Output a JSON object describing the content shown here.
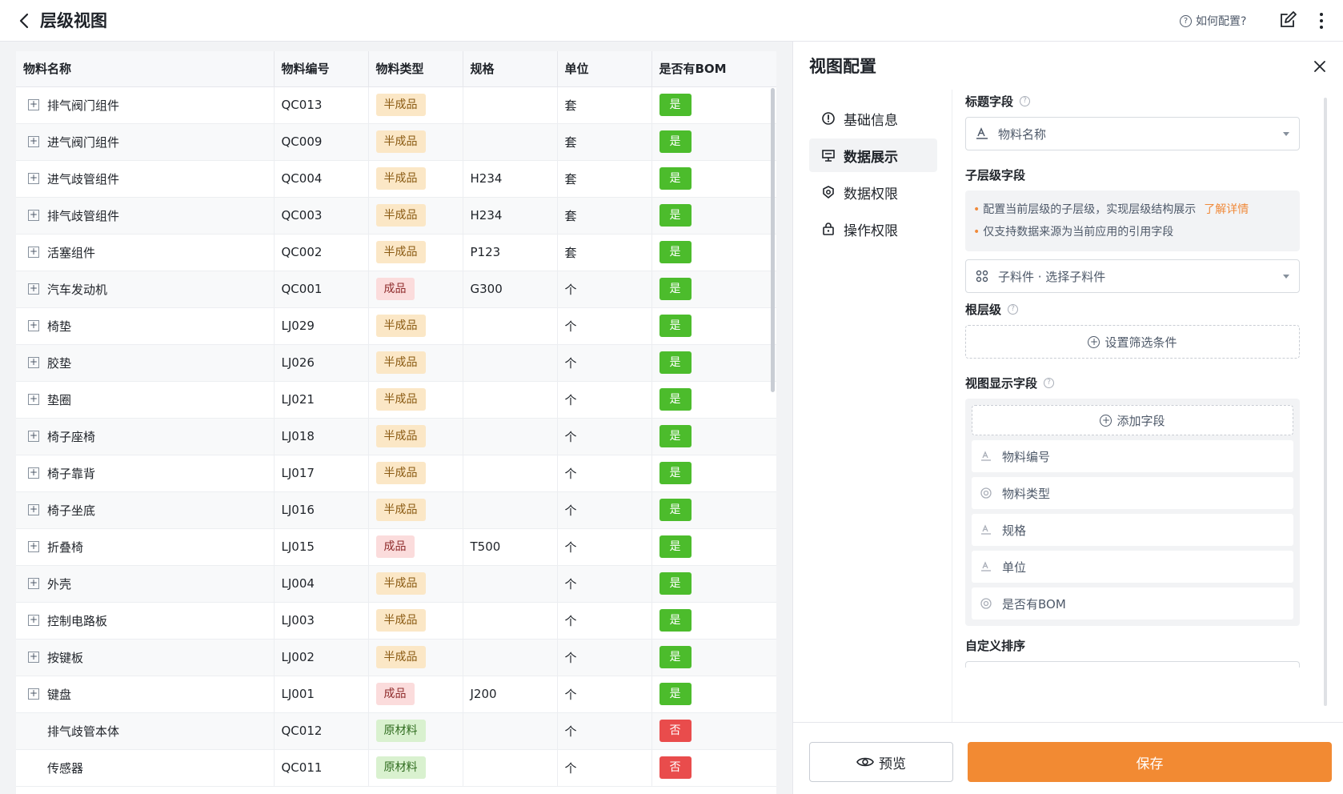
{
  "header": {
    "title": "层级视图",
    "help_label": "如何配置?"
  },
  "table": {
    "columns": [
      "物料名称",
      "物料编号",
      "物料类型",
      "规格",
      "单位",
      "是否有BOM"
    ],
    "rows": [
      {
        "name": "排气阀门组件",
        "code": "QC013",
        "type": "半成品",
        "spec": "",
        "unit": "套",
        "bom": "是",
        "expandable": true
      },
      {
        "name": "进气阀门组件",
        "code": "QC009",
        "type": "半成品",
        "spec": "",
        "unit": "套",
        "bom": "是",
        "expandable": true
      },
      {
        "name": "进气歧管组件",
        "code": "QC004",
        "type": "半成品",
        "spec": "H234",
        "unit": "套",
        "bom": "是",
        "expandable": true
      },
      {
        "name": "排气歧管组件",
        "code": "QC003",
        "type": "半成品",
        "spec": "H234",
        "unit": "套",
        "bom": "是",
        "expandable": true
      },
      {
        "name": "活塞组件",
        "code": "QC002",
        "type": "半成品",
        "spec": "P123",
        "unit": "套",
        "bom": "是",
        "expandable": true
      },
      {
        "name": "汽车发动机",
        "code": "QC001",
        "type": "成品",
        "spec": "G300",
        "unit": "个",
        "bom": "是",
        "expandable": true
      },
      {
        "name": "椅垫",
        "code": "LJ029",
        "type": "半成品",
        "spec": "",
        "unit": "个",
        "bom": "是",
        "expandable": true
      },
      {
        "name": "胶垫",
        "code": "LJ026",
        "type": "半成品",
        "spec": "",
        "unit": "个",
        "bom": "是",
        "expandable": true
      },
      {
        "name": "垫圈",
        "code": "LJ021",
        "type": "半成品",
        "spec": "",
        "unit": "个",
        "bom": "是",
        "expandable": true
      },
      {
        "name": "椅子座椅",
        "code": "LJ018",
        "type": "半成品",
        "spec": "",
        "unit": "个",
        "bom": "是",
        "expandable": true
      },
      {
        "name": "椅子靠背",
        "code": "LJ017",
        "type": "半成品",
        "spec": "",
        "unit": "个",
        "bom": "是",
        "expandable": true
      },
      {
        "name": "椅子坐底",
        "code": "LJ016",
        "type": "半成品",
        "spec": "",
        "unit": "个",
        "bom": "是",
        "expandable": true
      },
      {
        "name": "折叠椅",
        "code": "LJ015",
        "type": "成品",
        "spec": "T500",
        "unit": "个",
        "bom": "是",
        "expandable": true
      },
      {
        "name": "外壳",
        "code": "LJ004",
        "type": "半成品",
        "spec": "",
        "unit": "个",
        "bom": "是",
        "expandable": true
      },
      {
        "name": "控制电路板",
        "code": "LJ003",
        "type": "半成品",
        "spec": "",
        "unit": "个",
        "bom": "是",
        "expandable": true
      },
      {
        "name": "按键板",
        "code": "LJ002",
        "type": "半成品",
        "spec": "",
        "unit": "个",
        "bom": "是",
        "expandable": true
      },
      {
        "name": "键盘",
        "code": "LJ001",
        "type": "成品",
        "spec": "J200",
        "unit": "个",
        "bom": "是",
        "expandable": true
      },
      {
        "name": "排气歧管本体",
        "code": "QC012",
        "type": "原材料",
        "spec": "",
        "unit": "个",
        "bom": "否",
        "expandable": false
      },
      {
        "name": "传感器",
        "code": "QC011",
        "type": "原材料",
        "spec": "",
        "unit": "个",
        "bom": "否",
        "expandable": false
      }
    ]
  },
  "panel": {
    "title": "视图配置",
    "nav": [
      {
        "label": "基础信息",
        "icon": "info-icon",
        "active": false
      },
      {
        "label": "数据展示",
        "icon": "display-icon",
        "active": true
      },
      {
        "label": "数据权限",
        "icon": "data-permission-icon",
        "active": false
      },
      {
        "label": "操作权限",
        "icon": "lock-icon",
        "active": false
      }
    ],
    "title_field": {
      "label": "标题字段",
      "value": "物料名称"
    },
    "child_field": {
      "label": "子层级字段",
      "note1": "配置当前层级的子层级，实现层级结构展示",
      "note1_link": "了解详情",
      "note2": "仅支持数据来源为当前应用的引用字段",
      "value": "子料件 · 选择子料件"
    },
    "root": {
      "label": "根层级",
      "button": "设置筛选条件"
    },
    "display_fields": {
      "label": "视图显示字段",
      "add_button": "添加字段",
      "items": [
        {
          "label": "物料编号",
          "icon": "text-icon"
        },
        {
          "label": "物料类型",
          "icon": "option-icon"
        },
        {
          "label": "规格",
          "icon": "text-icon"
        },
        {
          "label": "单位",
          "icon": "text-icon"
        },
        {
          "label": "是否有BOM",
          "icon": "option-icon"
        }
      ]
    },
    "sort": {
      "label": "自定义排序"
    },
    "footer": {
      "preview": "预览",
      "save": "保存"
    }
  },
  "colors": {
    "accent": "#f28a33",
    "yes": "#4cbc2c",
    "no": "#e94c4c",
    "semi_tag": "#fbe7c6",
    "finished_tag": "#fbdcdc",
    "raw_tag": "#d9f1cf"
  }
}
